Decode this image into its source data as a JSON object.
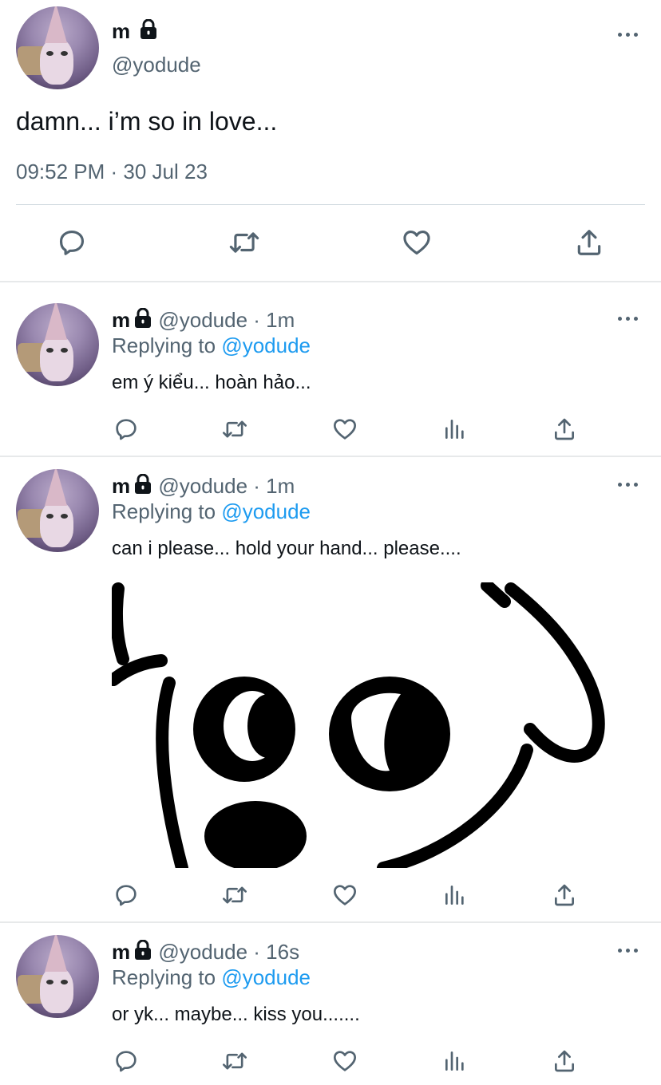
{
  "main_tweet": {
    "name": "m",
    "handle": "@yodude",
    "text": "damn... i’m so in love...",
    "timestamp": "09:52 PM · 30 Jul 23"
  },
  "replies": [
    {
      "name": "m",
      "handle": "@yodude",
      "time": "1m",
      "replying_prefix": "Replying to",
      "replying_to": "@yodude",
      "text": "em ý kiểu... hoàn hảo..."
    },
    {
      "name": "m",
      "handle": "@yodude",
      "time": "1m",
      "replying_prefix": "Replying to",
      "replying_to": "@yodude",
      "text": "can i please... hold your hand... please...."
    },
    {
      "name": "m",
      "handle": "@yodude",
      "time": "16s",
      "replying_prefix": "Replying to",
      "replying_to": "@yodude",
      "text": "or yk... maybe... kiss you......."
    }
  ],
  "icons": {
    "reply": "speech-bubble",
    "retweet": "retweet-arrows",
    "like": "heart",
    "views": "bar-chart",
    "share": "upload-arrow",
    "protected": "lock",
    "more": "ellipsis"
  },
  "colors": {
    "text": "#0f1419",
    "secondary": "#536471",
    "link": "#1d9bf0",
    "divider": "#cfd9de"
  }
}
